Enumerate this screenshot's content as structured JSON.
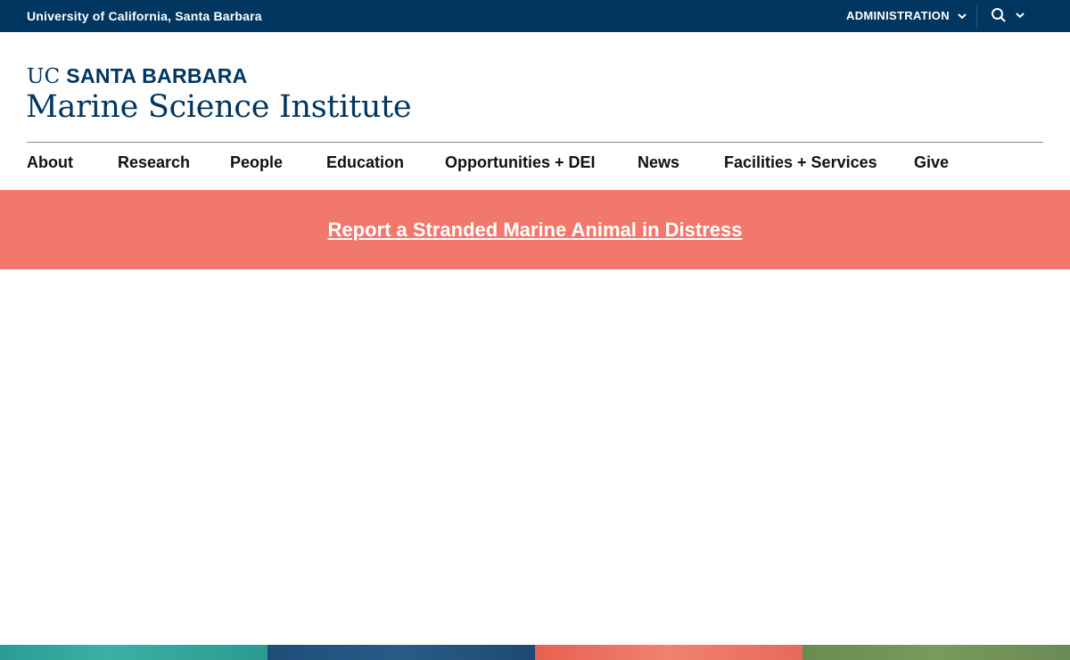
{
  "topbar": {
    "university": "University of California, Santa Barbara",
    "admin_label": "ADMINISTRATION",
    "admin_icon": "chevron-down-icon",
    "search_icon": "search-icon",
    "search_chevron_icon": "chevron-down-icon"
  },
  "logo": {
    "uc": "UC",
    "santa_barbara": "SANTA BARBARA",
    "site_name": "Marine Science Institute"
  },
  "nav": {
    "items": [
      {
        "label": "About"
      },
      {
        "label": "Research"
      },
      {
        "label": "People"
      },
      {
        "label": "Education"
      },
      {
        "label": "Opportunities + DEI"
      },
      {
        "label": "News"
      },
      {
        "label": "Facilities + Services"
      },
      {
        "label": "Give"
      }
    ]
  },
  "alert": {
    "link_text": "Report a Stranded Marine Animal in Distress"
  },
  "colors": {
    "navy": "#003660",
    "alert": "#f2776c"
  }
}
